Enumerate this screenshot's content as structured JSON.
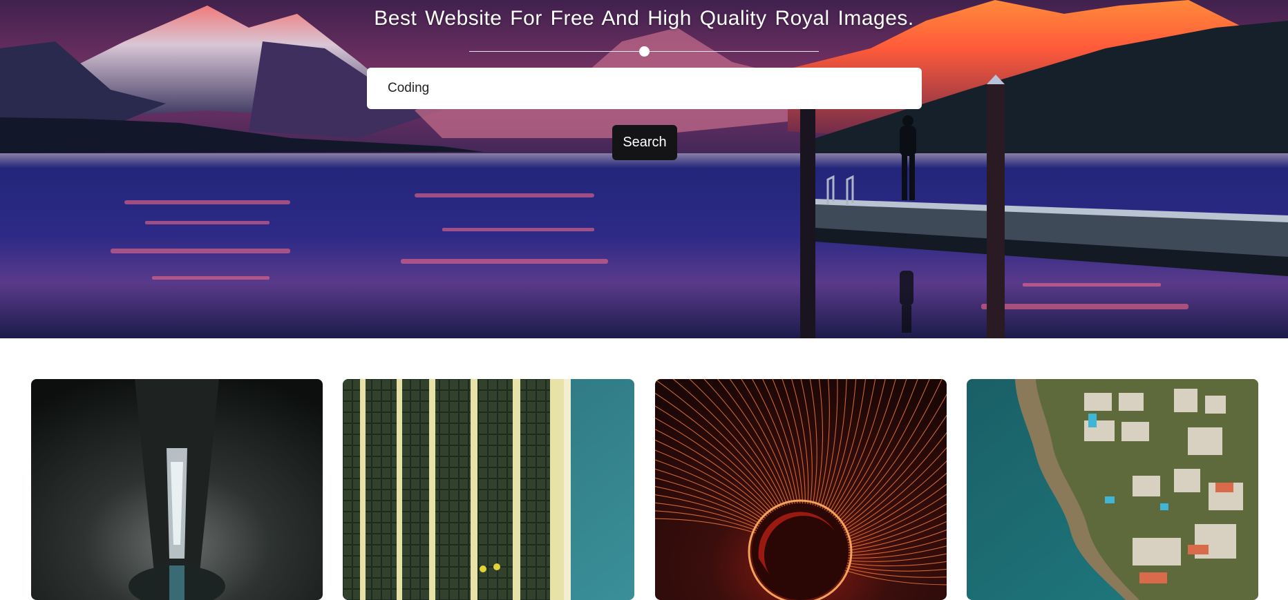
{
  "hero": {
    "title": "Best Website For Free And High Quality Royal Images.",
    "slider": {
      "value_percent": 50
    }
  },
  "search": {
    "input_value": "Coding",
    "button_label": "Search"
  },
  "gallery": {
    "images": [
      {
        "name": "tunnel-image"
      },
      {
        "name": "skyscraper-image"
      },
      {
        "name": "light-tunnel-image"
      },
      {
        "name": "coastline-image"
      }
    ]
  }
}
